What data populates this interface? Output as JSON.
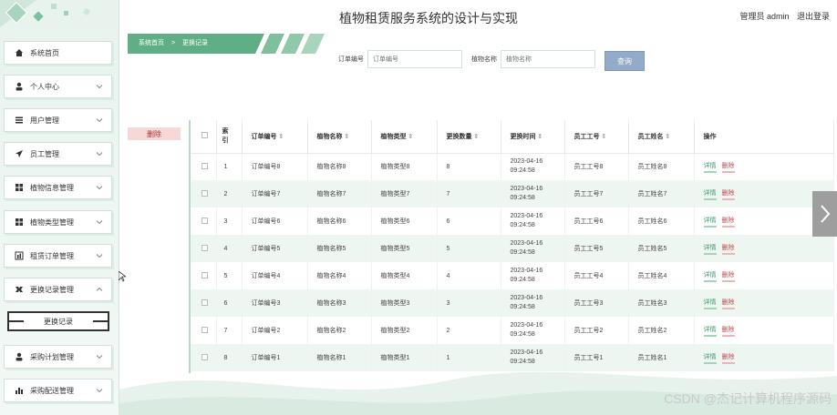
{
  "header": {
    "title": "植物租赁服务系统的设计与实现",
    "user_label": "管理员 admin",
    "logout": "退出登录"
  },
  "breadcrumb": {
    "home": "系统首页",
    "sep": ">",
    "current": "更换记录"
  },
  "search": {
    "order_label": "订单编号",
    "order_placeholder": "订单编号",
    "plant_label": "植物名称",
    "plant_placeholder": "植物名称",
    "query_button": "查询"
  },
  "toolbar": {
    "delete_button": "删除"
  },
  "sidebar": {
    "items": [
      {
        "label": "系统首页",
        "icon": "home-icon",
        "chevron": false
      },
      {
        "label": "个人中心",
        "icon": "user-icon",
        "chevron": true
      },
      {
        "label": "用户管理",
        "icon": "list-icon",
        "chevron": true
      },
      {
        "label": "员工管理",
        "icon": "send-icon",
        "chevron": true
      },
      {
        "label": "植物信息管理",
        "icon": "grid-icon",
        "chevron": true
      },
      {
        "label": "植物类型管理",
        "icon": "grid-icon",
        "chevron": true
      },
      {
        "label": "租赁订单管理",
        "icon": "chart-icon",
        "chevron": true
      },
      {
        "label": "更换记录管理",
        "icon": "tools-icon",
        "chevron": true,
        "expanded": true
      },
      {
        "label": "采购计划管理",
        "icon": "user-icon",
        "chevron": true
      },
      {
        "label": "采购配送管理",
        "icon": "bar-icon",
        "chevron": true
      }
    ],
    "submenu_item": "更换记录"
  },
  "table": {
    "headers": [
      "索引",
      "订单编号",
      "植物名称",
      "植物类型",
      "更换数量",
      "更换时间",
      "员工工号",
      "员工姓名",
      "操作"
    ],
    "index_header_line1": "索",
    "index_header_line2": "引",
    "detail_label": "详情",
    "delete_label": "删除",
    "rows": [
      {
        "idx": "1",
        "order": "订单编号8",
        "plant": "植物名称8",
        "type": "植物类型8",
        "qty": "8",
        "date": "2023-04-16",
        "time": "09:24:58",
        "emp_no": "员工工号8",
        "emp_name": "员工姓名8"
      },
      {
        "idx": "2",
        "order": "订单编号7",
        "plant": "植物名称7",
        "type": "植物类型7",
        "qty": "7",
        "date": "2023-04-16",
        "time": "09:24:58",
        "emp_no": "员工工号7",
        "emp_name": "员工姓名7"
      },
      {
        "idx": "3",
        "order": "订单编号6",
        "plant": "植物名称6",
        "type": "植物类型6",
        "qty": "6",
        "date": "2023-04-16",
        "time": "09:24:58",
        "emp_no": "员工工号6",
        "emp_name": "员工姓名6"
      },
      {
        "idx": "4",
        "order": "订单编号5",
        "plant": "植物名称5",
        "type": "植物类型5",
        "qty": "5",
        "date": "2023-04-16",
        "time": "09:24:58",
        "emp_no": "员工工号5",
        "emp_name": "员工姓名5"
      },
      {
        "idx": "5",
        "order": "订单编号4",
        "plant": "植物名称4",
        "type": "植物类型4",
        "qty": "4",
        "date": "2023-04-16",
        "time": "09:24:58",
        "emp_no": "员工工号4",
        "emp_name": "员工姓名4"
      },
      {
        "idx": "6",
        "order": "订单编号3",
        "plant": "植物名称3",
        "type": "植物类型3",
        "qty": "3",
        "date": "2023-04-16",
        "time": "09:24:58",
        "emp_no": "员工工号3",
        "emp_name": "员工姓名3"
      },
      {
        "idx": "7",
        "order": "订单编号2",
        "plant": "植物名称2",
        "type": "植物类型2",
        "qty": "2",
        "date": "2023-04-16",
        "time": "09:24:58",
        "emp_no": "员工工号2",
        "emp_name": "员工姓名2"
      },
      {
        "idx": "8",
        "order": "订单编号1",
        "plant": "植物名称1",
        "type": "植物类型1",
        "qty": "1",
        "date": "2023-04-16",
        "time": "09:24:58",
        "emp_no": "员工工号1",
        "emp_name": "员工姓名1"
      }
    ]
  },
  "watermark": "CSDN @杰记计算机程序源码",
  "colors": {
    "accent": "#3a9a6a",
    "query_button": "#93aac8",
    "danger": "#c24a4a",
    "row_alt": "#eef6f1"
  }
}
